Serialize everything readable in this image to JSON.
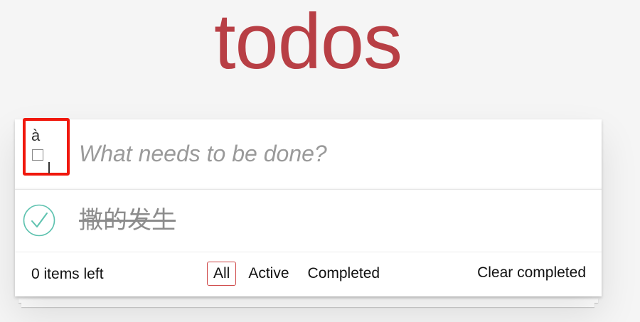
{
  "app": {
    "title": "todos"
  },
  "header": {
    "toggle_all_glyph": "à",
    "new_todo_placeholder": "What needs to be done?",
    "new_todo_value": ""
  },
  "todos": [
    {
      "label": "撒的发生",
      "completed": true
    }
  ],
  "footer": {
    "count_text": "0 items left",
    "filters": [
      {
        "label": "All",
        "selected": true
      },
      {
        "label": "Active",
        "selected": false
      },
      {
        "label": "Completed",
        "selected": false
      }
    ],
    "clear_completed_label": "Clear completed"
  },
  "colors": {
    "title": "#b83f45",
    "check": "#5dc2af",
    "highlight_box": "#f0180d",
    "selected_filter_border": "#ce4646"
  },
  "icons": {
    "toggle_all": "toggle-all-icon",
    "completed_check": "check-circle-icon"
  }
}
